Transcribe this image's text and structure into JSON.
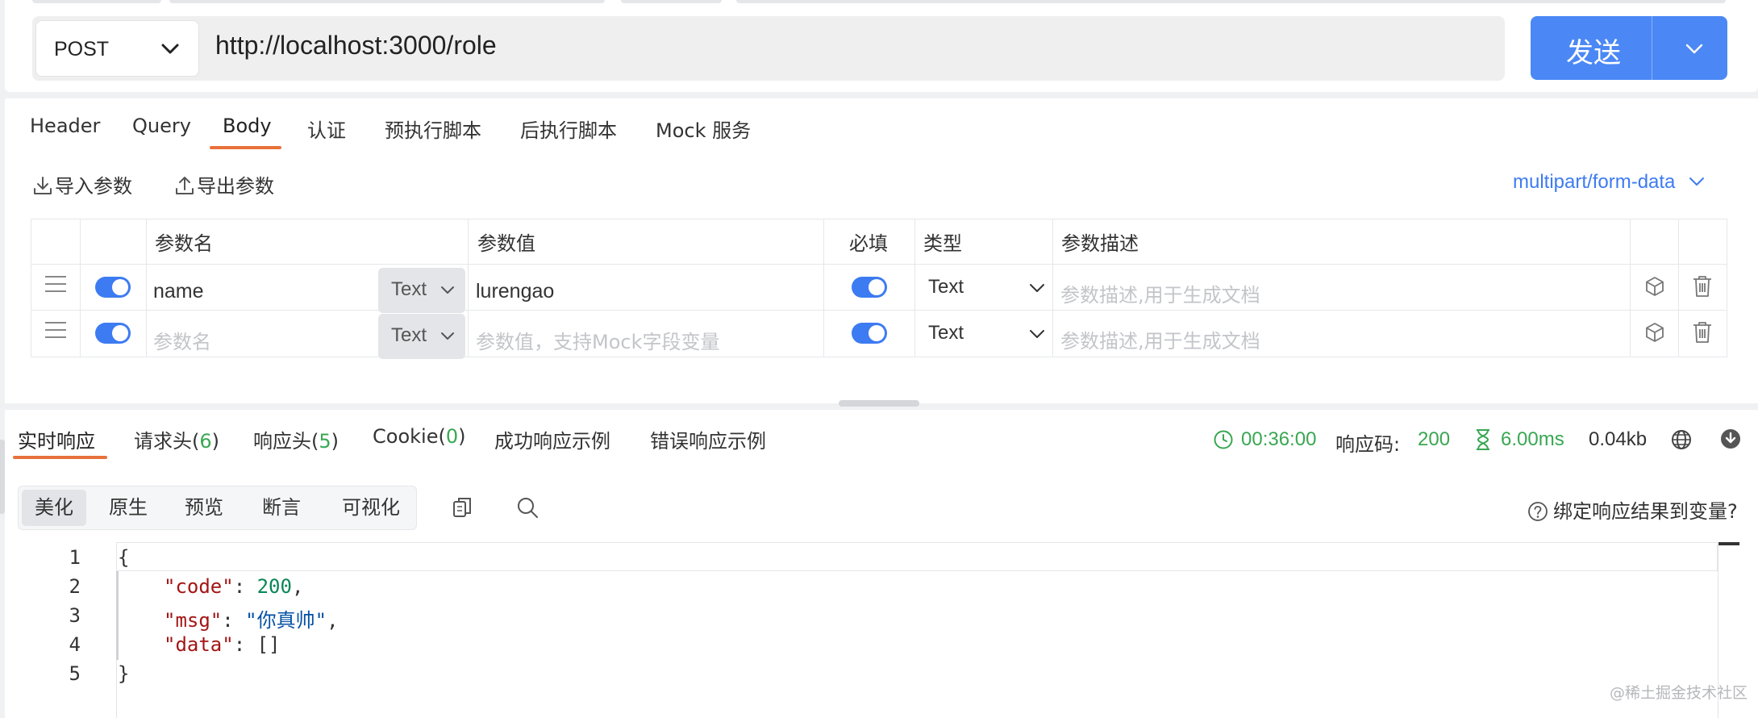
{
  "request": {
    "method": "POST",
    "url": "http://localhost:3000/role",
    "send_label": "发送"
  },
  "request_tabs": [
    "Header",
    "Query",
    "Body",
    "认证",
    "预执行脚本",
    "后执行脚本",
    "Mock 服务"
  ],
  "active_request_tab": "Body",
  "body_toolbar": {
    "import_label": "导入参数",
    "export_label": "导出参数",
    "content_type": "multipart/form-data"
  },
  "params_table": {
    "headers": {
      "name": "参数名",
      "value": "参数值",
      "required": "必填",
      "type": "类型",
      "description": "参数描述"
    },
    "rows": [
      {
        "enabled": true,
        "name": "name",
        "name_type": "Text",
        "value": "lurengao",
        "required": true,
        "type": "Text",
        "description_placeholder": "参数描述,用于生成文档"
      },
      {
        "enabled": true,
        "name_placeholder": "参数名",
        "name_type": "Text",
        "value_placeholder": "参数值，支持Mock字段变量",
        "required": true,
        "type": "Text",
        "description_placeholder": "参数描述,用于生成文档"
      }
    ]
  },
  "response": {
    "tabs": {
      "realtime": "实时响应",
      "req_headers": "请求头(",
      "req_headers_count": "6",
      "res_headers": "响应头(",
      "res_headers_count": "5",
      "cookie": "Cookie(",
      "cookie_count": "0",
      "close_paren": ")",
      "success_example": "成功响应示例",
      "error_example": "错误响应示例"
    },
    "stats": {
      "time": "00:36:00",
      "code_label": "响应码:",
      "code": "200",
      "duration": "6.00ms",
      "size": "0.04kb"
    },
    "view_modes": [
      "美化",
      "原生",
      "预览",
      "断言",
      "可视化"
    ],
    "active_view_mode": "美化",
    "bind_label": "绑定响应结果到变量?",
    "code_lines": [
      "1",
      "2",
      "3",
      "4",
      "5"
    ],
    "json": {
      "open": "{",
      "close": "}",
      "code_key": "\"code\"",
      "code_value": "200",
      "msg_key": "\"msg\"",
      "msg_value": "\"你真帅\"",
      "data_key": "\"data\"",
      "data_value": "[]"
    }
  },
  "watermark": "@稀土掘金技术社区",
  "colors": {
    "primary": "#4b88f5",
    "link": "#3d7bf2",
    "tab_underline": "#e8713a",
    "success": "#39a752"
  }
}
